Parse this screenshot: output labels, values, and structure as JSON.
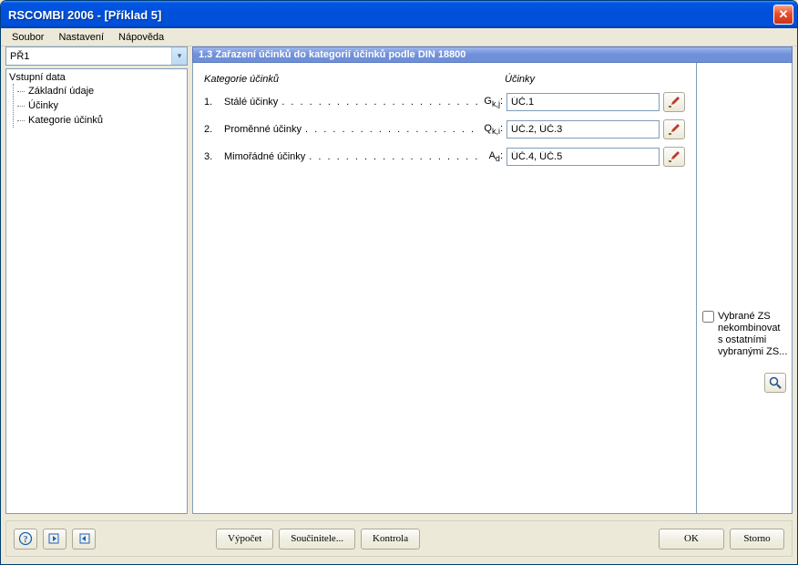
{
  "window": {
    "title": "RSCOMBI 2006 - [Příklad 5]"
  },
  "menubar": {
    "items": [
      "Soubor",
      "Nastavení",
      "Nápověda"
    ]
  },
  "dropdown": {
    "selected": "PŘ1"
  },
  "tree": {
    "root": "Vstupní data",
    "children": [
      "Základní údaje",
      "Účinky",
      "Kategorie účinků"
    ]
  },
  "panel": {
    "title": "1.3 Zařazení účinků do kategorií účinků podle DIN 18800"
  },
  "table": {
    "header_cat": "Kategorie účinků",
    "header_eff": "Účinky",
    "rows": [
      {
        "num": "1.",
        "label": "Stálé účinky",
        "symbol_html": "G<sub>k,j</sub>:",
        "value": "ÚČ.1"
      },
      {
        "num": "2.",
        "label": "Proměnné účinky",
        "symbol_html": "Q<sub>k,i</sub>:",
        "value": "ÚČ.2, ÚČ.3"
      },
      {
        "num": "3.",
        "label": "Mimořádné účinky",
        "symbol_html": "A<sub>d</sub>:",
        "value": "ÚČ.4, ÚČ.5"
      }
    ]
  },
  "side": {
    "checkbox_label": "Vybrané ZS nekombinovat s ostatními vybranými ZS..."
  },
  "bottom": {
    "vypocet": "Výpočet",
    "soucinitele": "Součinitele...",
    "kontrola": "Kontrola",
    "ok": "OK",
    "storno": "Storno"
  },
  "dots": ". . . . . . . . . . . . . . . . . . . . . . . . . . . . . . . . . . . . . . . . . . . . . . . . . . . . . . . . . . . . . ."
}
